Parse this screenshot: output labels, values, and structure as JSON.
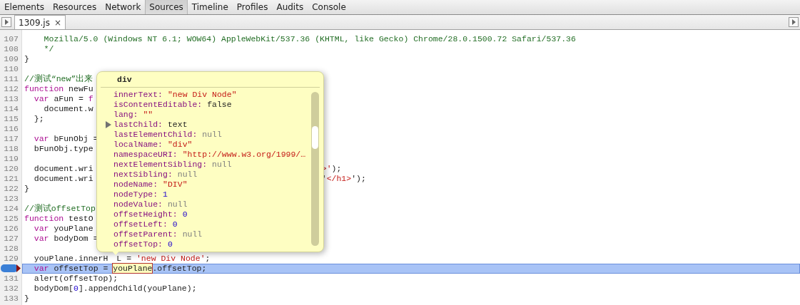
{
  "panel_tabs": [
    {
      "label": "Elements",
      "selected": false
    },
    {
      "label": "Resources",
      "selected": false
    },
    {
      "label": "Network",
      "selected": false
    },
    {
      "label": "Sources",
      "selected": true
    },
    {
      "label": "Timeline",
      "selected": false
    },
    {
      "label": "Profiles",
      "selected": false
    },
    {
      "label": "Audits",
      "selected": false
    },
    {
      "label": "Console",
      "selected": false
    }
  ],
  "file_tabs": [
    {
      "label": "1309.js",
      "close": "×",
      "selected": true
    }
  ],
  "lines": [
    {
      "number": "107",
      "tokens": [
        {
          "kind": "comment",
          "text": "    Mozilla/5.0 (Windows NT 6.1; WOW64) AppleWebKit/537.36 (KHTML, like Gecko) Chrome/28.0.1500.72 Safari/537.36"
        }
      ]
    },
    {
      "number": "108",
      "tokens": [
        {
          "kind": "comment",
          "text": "    */"
        }
      ]
    },
    {
      "number": "109",
      "tokens": [
        {
          "kind": "plain",
          "text": "}"
        }
      ]
    },
    {
      "number": "110"
    },
    {
      "number": "111",
      "tokens": [
        {
          "kind": "comment",
          "text": "//测试“new”出来"
        }
      ]
    },
    {
      "number": "112",
      "tokens": [
        {
          "kind": "keyword",
          "text": "function"
        },
        {
          "kind": "plain",
          "text": " newFu"
        }
      ]
    },
    {
      "number": "113",
      "tokens": [
        {
          "kind": "keyword",
          "text": "  var"
        },
        {
          "kind": "plain",
          "text": " aFun = "
        },
        {
          "kind": "keyword",
          "text": "f"
        }
      ]
    },
    {
      "number": "114",
      "tokens": [
        {
          "kind": "plain",
          "text": "    document.w"
        }
      ]
    },
    {
      "number": "115",
      "tokens": [
        {
          "kind": "plain",
          "text": "  };"
        }
      ]
    },
    {
      "number": "116"
    },
    {
      "number": "117",
      "tokens": [
        {
          "kind": "keyword",
          "text": "  var"
        },
        {
          "kind": "plain",
          "text": " bFunObj ="
        }
      ]
    },
    {
      "number": "118",
      "tokens": [
        {
          "kind": "plain",
          "text": "  bFunObj.type"
        }
      ]
    },
    {
      "number": "119"
    },
    {
      "number": "120",
      "tokens": [
        {
          "kind": "plain",
          "text": "  document.wri"
        }
      ],
      "rest": [
        {
          "kind": "string",
          "text": ">'"
        },
        {
          "kind": "plain",
          "text": ");"
        }
      ]
    },
    {
      "number": "121",
      "tokens": [
        {
          "kind": "plain",
          "text": "  document.wri"
        }
      ],
      "rest": [
        {
          "kind": "plain",
          "text": "'"
        },
        {
          "kind": "string",
          "text": "</h1>"
        },
        {
          "kind": "plain",
          "text": "');"
        }
      ]
    },
    {
      "number": "122",
      "tokens": [
        {
          "kind": "plain",
          "text": "}"
        }
      ]
    },
    {
      "number": "123"
    },
    {
      "number": "124",
      "tokens": [
        {
          "kind": "comment",
          "text": "//测试offsetTop"
        }
      ]
    },
    {
      "number": "125",
      "tokens": [
        {
          "kind": "keyword",
          "text": "function"
        },
        {
          "kind": "plain",
          "text": " testO"
        }
      ]
    },
    {
      "number": "126",
      "tokens": [
        {
          "kind": "keyword",
          "text": "  var"
        },
        {
          "kind": "plain",
          "text": " youPlane"
        }
      ]
    },
    {
      "number": "127",
      "tokens": [
        {
          "kind": "keyword",
          "text": "  var"
        },
        {
          "kind": "plain",
          "text": " bodyDom ="
        }
      ]
    },
    {
      "number": "128"
    },
    {
      "number": "129",
      "tokens": [
        {
          "kind": "plain",
          "text": "  youPlane.innerH"
        }
      ],
      "rest": [
        {
          "kind": "plain",
          "text": "L = "
        },
        {
          "kind": "string",
          "text": "'new Div Node'"
        },
        {
          "kind": "plain",
          "text": ";"
        }
      ]
    },
    {
      "current": true,
      "tokens": [
        {
          "kind": "keyword",
          "text": "  var"
        },
        {
          "kind": "plain",
          "text": " offsetTop = "
        },
        {
          "kind": "hovered",
          "text": "youPlane"
        },
        {
          "kind": "plain",
          "text": ".offsetTop;"
        }
      ]
    },
    {
      "number": "131",
      "tokens": [
        {
          "kind": "plain",
          "text": "  alert(offsetTop);"
        }
      ]
    },
    {
      "number": "132",
      "tokens": [
        {
          "kind": "plain",
          "text": "  bodyDom["
        },
        {
          "kind": "number",
          "text": "0"
        },
        {
          "kind": "plain",
          "text": "].appendChild(youPlane);"
        }
      ]
    },
    {
      "number": "133",
      "tokens": [
        {
          "kind": "plain",
          "text": "}"
        }
      ]
    }
  ],
  "popover": {
    "title": "div",
    "properties": [
      {
        "name": "innerText:",
        "value": "\"new Div Node\"",
        "kind": "string",
        "expandable": false
      },
      {
        "name": "isContentEditable:",
        "value": "false",
        "kind": "plain",
        "expandable": false
      },
      {
        "name": "lang:",
        "value": "\"\"",
        "kind": "string",
        "expandable": false
      },
      {
        "name": "lastChild:",
        "value": "text",
        "kind": "plain",
        "expandable": true
      },
      {
        "name": "lastElementChild:",
        "value": "null",
        "kind": "null",
        "expandable": false
      },
      {
        "name": "localName:",
        "value": "\"div\"",
        "kind": "string",
        "expandable": false
      },
      {
        "name": "namespaceURI:",
        "value": "\"http://www.w3.org/1999/…",
        "kind": "string",
        "expandable": false
      },
      {
        "name": "nextElementSibling:",
        "value": "null",
        "kind": "null",
        "expandable": false
      },
      {
        "name": "nextSibling:",
        "value": "null",
        "kind": "null",
        "expandable": false
      },
      {
        "name": "nodeName:",
        "value": "\"DIV\"",
        "kind": "string",
        "expandable": false
      },
      {
        "name": "nodeType:",
        "value": "1",
        "kind": "number",
        "expandable": false
      },
      {
        "name": "nodeValue:",
        "value": "null",
        "kind": "null",
        "expandable": false
      },
      {
        "name": "offsetHeight:",
        "value": "0",
        "kind": "number",
        "expandable": false
      },
      {
        "name": "offsetLeft:",
        "value": "0",
        "kind": "number",
        "expandable": false
      },
      {
        "name": "offsetParent:",
        "value": "null",
        "kind": "null",
        "expandable": false
      },
      {
        "name": "offsetTop:",
        "value": "0",
        "kind": "number",
        "expandable": false
      }
    ]
  }
}
